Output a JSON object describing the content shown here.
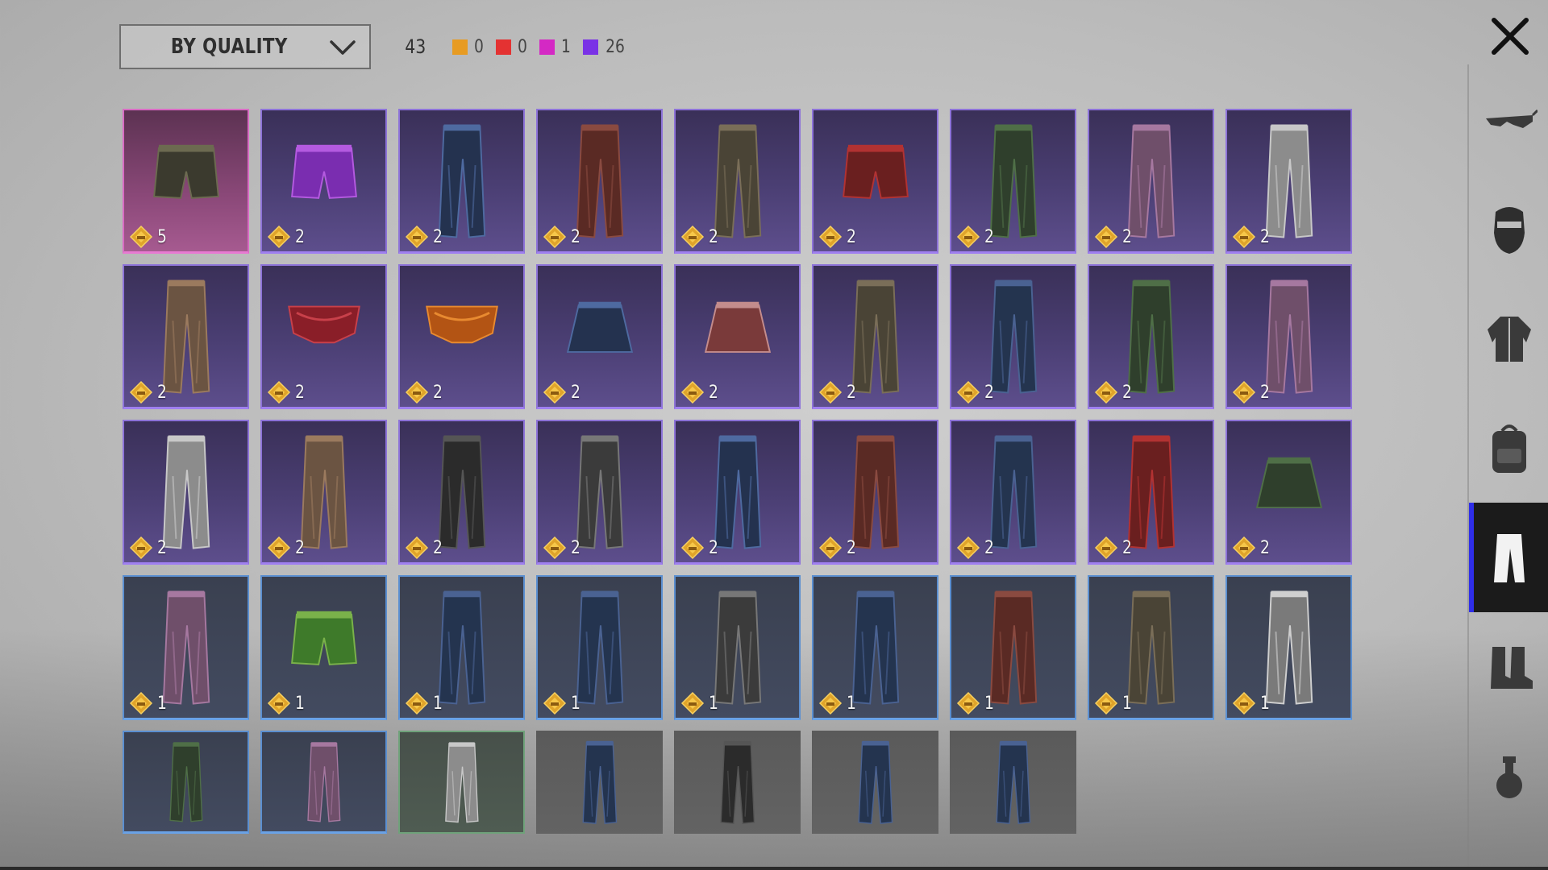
{
  "header": {
    "sort_label": "BY QUALITY",
    "total_count": "43",
    "quality_counts": [
      {
        "name": "legendary",
        "color": "#e79b22",
        "count": "0"
      },
      {
        "name": "epic",
        "color": "#e43232",
        "count": "0"
      },
      {
        "name": "rare-pink",
        "color": "#d429c4",
        "count": "1"
      },
      {
        "name": "purple",
        "color": "#7a32e6",
        "count": "26"
      }
    ]
  },
  "sidebar": {
    "items": [
      {
        "name": "glasses-icon"
      },
      {
        "name": "mask-icon"
      },
      {
        "name": "jacket-icon"
      },
      {
        "name": "backpack-icon"
      },
      {
        "name": "pants-icon",
        "active": true
      },
      {
        "name": "boots-icon"
      },
      {
        "name": "grenade-icon"
      }
    ]
  },
  "items": [
    {
      "quality": "pink",
      "icon": "camo-shorts-icon",
      "count": "5"
    },
    {
      "quality": "purple",
      "icon": "purple-shorts-icon",
      "count": "2"
    },
    {
      "quality": "purple",
      "icon": "pants-icon",
      "count": "2"
    },
    {
      "quality": "purple",
      "icon": "pants-icon",
      "count": "2"
    },
    {
      "quality": "purple",
      "icon": "pants-icon",
      "count": "2"
    },
    {
      "quality": "purple",
      "icon": "shorts-icon",
      "count": "2"
    },
    {
      "quality": "purple",
      "icon": "pants-icon",
      "count": "2"
    },
    {
      "quality": "purple",
      "icon": "pants-icon",
      "count": "2"
    },
    {
      "quality": "purple",
      "icon": "pants-icon",
      "count": "2"
    },
    {
      "quality": "purple",
      "icon": "pants-icon",
      "count": "2"
    },
    {
      "quality": "purple",
      "icon": "red-briefs-icon",
      "count": "2"
    },
    {
      "quality": "purple",
      "icon": "orange-briefs-icon",
      "count": "2"
    },
    {
      "quality": "purple",
      "icon": "skirt-icon",
      "count": "2"
    },
    {
      "quality": "purple",
      "icon": "plaid-skirt-icon",
      "count": "2"
    },
    {
      "quality": "purple",
      "icon": "pants-icon",
      "count": "2"
    },
    {
      "quality": "purple",
      "icon": "jeans-icon",
      "count": "2"
    },
    {
      "quality": "purple",
      "icon": "pants-icon",
      "count": "2"
    },
    {
      "quality": "purple",
      "icon": "pants-icon",
      "count": "2"
    },
    {
      "quality": "purple",
      "icon": "pants-icon",
      "count": "2"
    },
    {
      "quality": "purple",
      "icon": "pants-icon",
      "count": "2"
    },
    {
      "quality": "purple",
      "icon": "pants-icon",
      "count": "2"
    },
    {
      "quality": "purple",
      "icon": "pants-icon",
      "count": "2"
    },
    {
      "quality": "purple",
      "icon": "pants-icon",
      "count": "2"
    },
    {
      "quality": "purple",
      "icon": "pants-icon",
      "count": "2"
    },
    {
      "quality": "purple",
      "icon": "jeans-icon",
      "count": "2"
    },
    {
      "quality": "purple",
      "icon": "pants-icon",
      "count": "2"
    },
    {
      "quality": "purple",
      "icon": "black-skirt-icon",
      "count": "2"
    },
    {
      "quality": "blue",
      "icon": "pants-icon",
      "count": "1"
    },
    {
      "quality": "blue",
      "icon": "green-shorts-icon",
      "count": "1"
    },
    {
      "quality": "blue",
      "icon": "jeans-icon",
      "count": "1"
    },
    {
      "quality": "blue",
      "icon": "jeans-icon",
      "count": "1"
    },
    {
      "quality": "blue",
      "icon": "pants-icon",
      "count": "1"
    },
    {
      "quality": "blue",
      "icon": "jeans-icon",
      "count": "1"
    },
    {
      "quality": "blue",
      "icon": "pants-icon",
      "count": "1"
    },
    {
      "quality": "blue",
      "icon": "pants-icon",
      "count": "1"
    },
    {
      "quality": "blue",
      "icon": "camo-pants-icon",
      "count": "1"
    },
    {
      "quality": "blue",
      "icon": "pants-icon",
      "count": ""
    },
    {
      "quality": "blue",
      "icon": "pants-icon",
      "count": ""
    },
    {
      "quality": "green",
      "icon": "pants-icon",
      "count": ""
    },
    {
      "quality": "gray",
      "icon": "jeans-icon",
      "count": ""
    },
    {
      "quality": "gray",
      "icon": "pants-icon",
      "count": ""
    },
    {
      "quality": "gray",
      "icon": "jeans-icon",
      "count": ""
    },
    {
      "quality": "gray",
      "icon": "jeans-icon",
      "count": ""
    }
  ]
}
